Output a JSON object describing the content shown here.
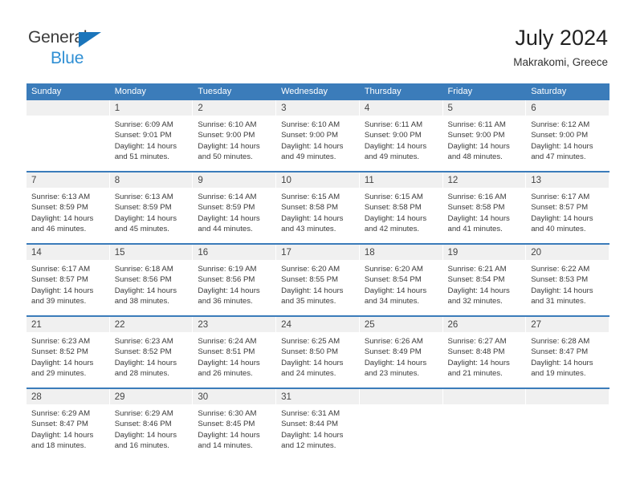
{
  "brand": {
    "line1": "General",
    "line2": "Blue",
    "accent_blue": "#1b75bb",
    "text_blue": "#2f8fd4"
  },
  "header": {
    "title": "July 2024",
    "location": "Makrakomi, Greece"
  },
  "calendar": {
    "header_bg": "#3b7cba",
    "numband_bg": "#f0f0f0",
    "weekday_labels": [
      "Sunday",
      "Monday",
      "Tuesday",
      "Wednesday",
      "Thursday",
      "Friday",
      "Saturday"
    ],
    "weeks": [
      [
        {
          "day": "",
          "lines": []
        },
        {
          "day": "1",
          "lines": [
            "Sunrise: 6:09 AM",
            "Sunset: 9:01 PM",
            "Daylight: 14 hours",
            "and 51 minutes."
          ]
        },
        {
          "day": "2",
          "lines": [
            "Sunrise: 6:10 AM",
            "Sunset: 9:00 PM",
            "Daylight: 14 hours",
            "and 50 minutes."
          ]
        },
        {
          "day": "3",
          "lines": [
            "Sunrise: 6:10 AM",
            "Sunset: 9:00 PM",
            "Daylight: 14 hours",
            "and 49 minutes."
          ]
        },
        {
          "day": "4",
          "lines": [
            "Sunrise: 6:11 AM",
            "Sunset: 9:00 PM",
            "Daylight: 14 hours",
            "and 49 minutes."
          ]
        },
        {
          "day": "5",
          "lines": [
            "Sunrise: 6:11 AM",
            "Sunset: 9:00 PM",
            "Daylight: 14 hours",
            "and 48 minutes."
          ]
        },
        {
          "day": "6",
          "lines": [
            "Sunrise: 6:12 AM",
            "Sunset: 9:00 PM",
            "Daylight: 14 hours",
            "and 47 minutes."
          ]
        }
      ],
      [
        {
          "day": "7",
          "lines": [
            "Sunrise: 6:13 AM",
            "Sunset: 8:59 PM",
            "Daylight: 14 hours",
            "and 46 minutes."
          ]
        },
        {
          "day": "8",
          "lines": [
            "Sunrise: 6:13 AM",
            "Sunset: 8:59 PM",
            "Daylight: 14 hours",
            "and 45 minutes."
          ]
        },
        {
          "day": "9",
          "lines": [
            "Sunrise: 6:14 AM",
            "Sunset: 8:59 PM",
            "Daylight: 14 hours",
            "and 44 minutes."
          ]
        },
        {
          "day": "10",
          "lines": [
            "Sunrise: 6:15 AM",
            "Sunset: 8:58 PM",
            "Daylight: 14 hours",
            "and 43 minutes."
          ]
        },
        {
          "day": "11",
          "lines": [
            "Sunrise: 6:15 AM",
            "Sunset: 8:58 PM",
            "Daylight: 14 hours",
            "and 42 minutes."
          ]
        },
        {
          "day": "12",
          "lines": [
            "Sunrise: 6:16 AM",
            "Sunset: 8:58 PM",
            "Daylight: 14 hours",
            "and 41 minutes."
          ]
        },
        {
          "day": "13",
          "lines": [
            "Sunrise: 6:17 AM",
            "Sunset: 8:57 PM",
            "Daylight: 14 hours",
            "and 40 minutes."
          ]
        }
      ],
      [
        {
          "day": "14",
          "lines": [
            "Sunrise: 6:17 AM",
            "Sunset: 8:57 PM",
            "Daylight: 14 hours",
            "and 39 minutes."
          ]
        },
        {
          "day": "15",
          "lines": [
            "Sunrise: 6:18 AM",
            "Sunset: 8:56 PM",
            "Daylight: 14 hours",
            "and 38 minutes."
          ]
        },
        {
          "day": "16",
          "lines": [
            "Sunrise: 6:19 AM",
            "Sunset: 8:56 PM",
            "Daylight: 14 hours",
            "and 36 minutes."
          ]
        },
        {
          "day": "17",
          "lines": [
            "Sunrise: 6:20 AM",
            "Sunset: 8:55 PM",
            "Daylight: 14 hours",
            "and 35 minutes."
          ]
        },
        {
          "day": "18",
          "lines": [
            "Sunrise: 6:20 AM",
            "Sunset: 8:54 PM",
            "Daylight: 14 hours",
            "and 34 minutes."
          ]
        },
        {
          "day": "19",
          "lines": [
            "Sunrise: 6:21 AM",
            "Sunset: 8:54 PM",
            "Daylight: 14 hours",
            "and 32 minutes."
          ]
        },
        {
          "day": "20",
          "lines": [
            "Sunrise: 6:22 AM",
            "Sunset: 8:53 PM",
            "Daylight: 14 hours",
            "and 31 minutes."
          ]
        }
      ],
      [
        {
          "day": "21",
          "lines": [
            "Sunrise: 6:23 AM",
            "Sunset: 8:52 PM",
            "Daylight: 14 hours",
            "and 29 minutes."
          ]
        },
        {
          "day": "22",
          "lines": [
            "Sunrise: 6:23 AM",
            "Sunset: 8:52 PM",
            "Daylight: 14 hours",
            "and 28 minutes."
          ]
        },
        {
          "day": "23",
          "lines": [
            "Sunrise: 6:24 AM",
            "Sunset: 8:51 PM",
            "Daylight: 14 hours",
            "and 26 minutes."
          ]
        },
        {
          "day": "24",
          "lines": [
            "Sunrise: 6:25 AM",
            "Sunset: 8:50 PM",
            "Daylight: 14 hours",
            "and 24 minutes."
          ]
        },
        {
          "day": "25",
          "lines": [
            "Sunrise: 6:26 AM",
            "Sunset: 8:49 PM",
            "Daylight: 14 hours",
            "and 23 minutes."
          ]
        },
        {
          "day": "26",
          "lines": [
            "Sunrise: 6:27 AM",
            "Sunset: 8:48 PM",
            "Daylight: 14 hours",
            "and 21 minutes."
          ]
        },
        {
          "day": "27",
          "lines": [
            "Sunrise: 6:28 AM",
            "Sunset: 8:47 PM",
            "Daylight: 14 hours",
            "and 19 minutes."
          ]
        }
      ],
      [
        {
          "day": "28",
          "lines": [
            "Sunrise: 6:29 AM",
            "Sunset: 8:47 PM",
            "Daylight: 14 hours",
            "and 18 minutes."
          ]
        },
        {
          "day": "29",
          "lines": [
            "Sunrise: 6:29 AM",
            "Sunset: 8:46 PM",
            "Daylight: 14 hours",
            "and 16 minutes."
          ]
        },
        {
          "day": "30",
          "lines": [
            "Sunrise: 6:30 AM",
            "Sunset: 8:45 PM",
            "Daylight: 14 hours",
            "and 14 minutes."
          ]
        },
        {
          "day": "31",
          "lines": [
            "Sunrise: 6:31 AM",
            "Sunset: 8:44 PM",
            "Daylight: 14 hours",
            "and 12 minutes."
          ]
        },
        {
          "day": "",
          "lines": []
        },
        {
          "day": "",
          "lines": []
        },
        {
          "day": "",
          "lines": []
        }
      ]
    ]
  }
}
